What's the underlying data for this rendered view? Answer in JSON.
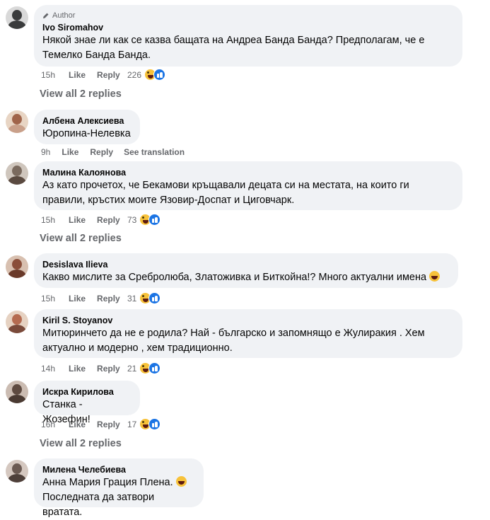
{
  "comments": [
    {
      "author": "Ivo Siromahov",
      "badge": "Author",
      "lines": [
        "Някой знае ли как се казва бащата на Андреа Банда Банда? Предполагам, че е",
        "Темелко Банда Банда."
      ],
      "time": "15h",
      "like": "Like",
      "reply": "Reply",
      "reactions": "226",
      "view_replies": "View all 2 replies",
      "avatar_color": "#3a3b3c"
    },
    {
      "author": "Албена Алексиева",
      "lines": [
        "Юропина-Нелевка"
      ],
      "time": "9h",
      "like": "Like",
      "reply": "Reply",
      "see_translation": "See translation",
      "avatar_color": "#a0644a"
    },
    {
      "author": "Малина Калоянова",
      "lines": [
        "Аз като прочетох, че Бекамови кръщавали децата си на местата, на които ги",
        "правили, кръстих моите Язовир-Доспат и Циговчарк."
      ],
      "time": "15h",
      "like": "Like",
      "reply": "Reply",
      "reactions": "73",
      "view_replies": "View all 2 replies",
      "avatar_color": "#7a6a5e"
    },
    {
      "author": "Desislava Ilieva",
      "lines": [
        "Какво мислите за Сребролюба, Златоживка и Биткойна!? Много актуални имена"
      ],
      "time": "15h",
      "like": "Like",
      "reply": "Reply",
      "reactions": "31",
      "avatar_color": "#8a4e3a"
    },
    {
      "author": "Kiril S. Stoyanov",
      "lines": [
        "Митюринчето да не е родила? Най - българско и запомнящо е Жулиракия . Хем",
        "актуално и модерно , хем традиционно."
      ],
      "time": "14h",
      "like": "Like",
      "reply": "Reply",
      "reactions": "21",
      "avatar_color": "#b56b50"
    },
    {
      "author": "Искра Кирилова",
      "lines": [
        "Станка - Жозефин!"
      ],
      "time": "16h",
      "like": "Like",
      "reply": "Reply",
      "reactions": "17",
      "view_replies": "View all 2 replies",
      "avatar_color": "#5e4a40"
    },
    {
      "author": "Милена Челебиева",
      "lines": [
        "Анна Мария Грация Плена.",
        "Последната да затвори вратата."
      ],
      "avatar_color": "#6b5a52"
    }
  ],
  "icons": {
    "reaction_haha": "haha-reaction-icon",
    "reaction_like": "like-reaction-icon",
    "author_badge": "pencil-icon",
    "inline_emoji": "laughing-emoji-icon"
  }
}
